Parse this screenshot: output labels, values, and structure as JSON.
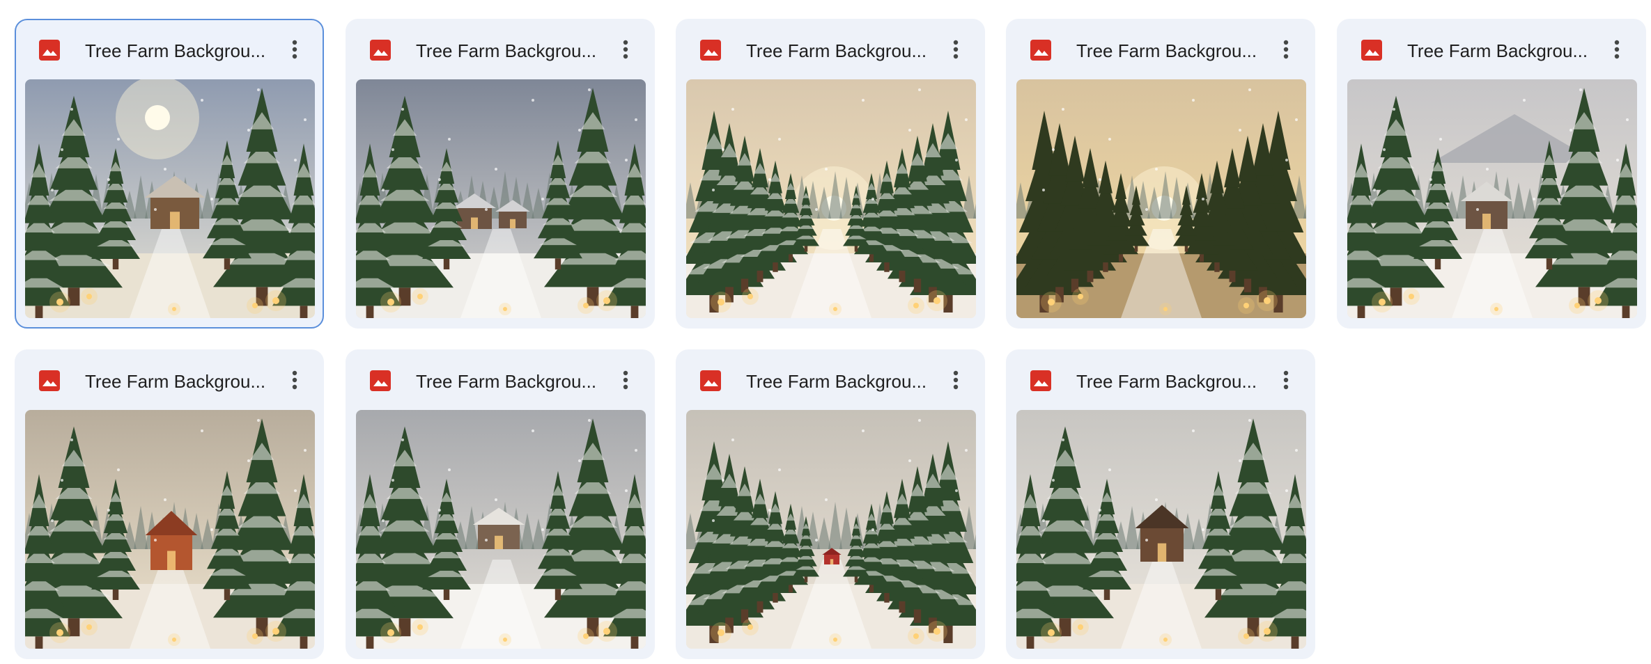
{
  "files": [
    {
      "title": "Tree Farm Backgrou...",
      "selected": true,
      "scene": "cabin-sun",
      "sky": [
        "#8f9bb0",
        "#e6e2d6"
      ],
      "ground": "#e9e2d2"
    },
    {
      "title": "Tree Farm Backgrou...",
      "selected": false,
      "scene": "village-snow",
      "sky": [
        "#7f8797",
        "#d8d6d2"
      ],
      "ground": "#f0eeea"
    },
    {
      "title": "Tree Farm Backgrou...",
      "selected": false,
      "scene": "row-sunset",
      "sky": [
        "#d9c8ae",
        "#f7e6c2"
      ],
      "ground": "#f2ece4"
    },
    {
      "title": "Tree Farm Backgrou...",
      "selected": false,
      "scene": "golden-path",
      "sky": [
        "#d8c39f",
        "#f4dba3"
      ],
      "ground": "#b59a6e"
    },
    {
      "title": "Tree Farm Backgrou...",
      "selected": false,
      "scene": "mountain-cabin",
      "sky": [
        "#c7c6c8",
        "#e8e2d8"
      ],
      "ground": "#f3efea"
    },
    {
      "title": "Tree Farm Backgrou...",
      "selected": false,
      "scene": "red-barn-sky",
      "sky": [
        "#b8ad9c",
        "#efe4cf"
      ],
      "ground": "#ece4d8"
    },
    {
      "title": "Tree Farm Backgrou...",
      "selected": false,
      "scene": "snowy-cabin",
      "sky": [
        "#a7a9ad",
        "#e5e0d8"
      ],
      "ground": "#f4f2ee"
    },
    {
      "title": "Tree Farm Backgrou...",
      "selected": false,
      "scene": "row-red-barn",
      "sky": [
        "#c6c1b8",
        "#ece3d6"
      ],
      "ground": "#efe9e0"
    },
    {
      "title": "Tree Farm Backgrou...",
      "selected": false,
      "scene": "barn-lanterns",
      "sky": [
        "#c8c6c2",
        "#ebe6de"
      ],
      "ground": "#ede6dc"
    }
  ],
  "icons": {
    "file_type": "image-file-icon",
    "more": "more-vert-icon"
  },
  "colors": {
    "file_icon": "#d93025",
    "selection_border": "#5b8fdb",
    "card_bg": "#eef2f9"
  }
}
